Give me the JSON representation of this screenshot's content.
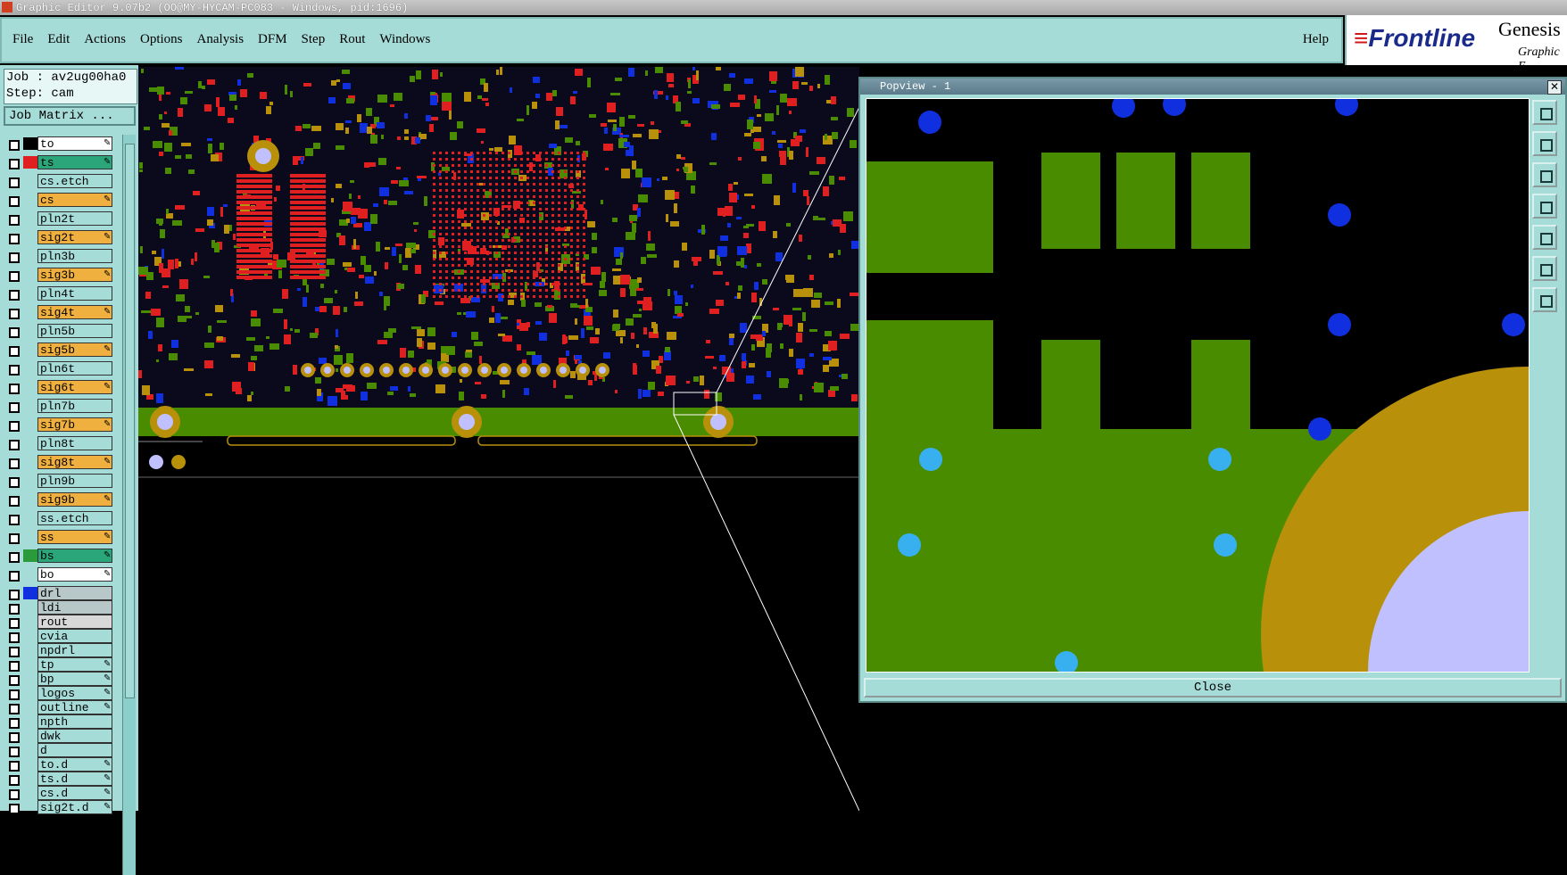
{
  "window": {
    "title": "Graphic Editor 9.07b2 (OO@MY-HYCAM-PC083 - Windows, pid:1696)"
  },
  "menu": {
    "items": [
      "File",
      "Edit",
      "Actions",
      "Options",
      "Analysis",
      "DFM",
      "Step",
      "Rout",
      "Windows"
    ],
    "help": "Help"
  },
  "brand": {
    "logo_text": "Frontline",
    "product": "Genesis",
    "subtitle": "Graphic E"
  },
  "info": {
    "job": "Job : av2ug00ha0",
    "step": "Step: cam"
  },
  "job_matrix_label": "Job Matrix ...",
  "layers": [
    {
      "name": "to",
      "color": "#ffffff",
      "swatch": "#000000",
      "locked": true
    },
    {
      "name": "ts",
      "color": "#2aa67a",
      "swatch": "#e02020",
      "locked": true
    },
    {
      "name": "cs.etch",
      "color": "#a6dcd8",
      "swatch": "",
      "locked": false
    },
    {
      "name": "cs",
      "color": "#f0b040",
      "swatch": "",
      "locked": true
    },
    {
      "name": "pln2t",
      "color": "#a6dcd8",
      "swatch": "",
      "locked": false
    },
    {
      "name": "sig2t",
      "color": "#f0b040",
      "swatch": "",
      "locked": true
    },
    {
      "name": "pln3b",
      "color": "#a6dcd8",
      "swatch": "",
      "locked": false
    },
    {
      "name": "sig3b",
      "color": "#f0b040",
      "swatch": "",
      "locked": true
    },
    {
      "name": "pln4t",
      "color": "#a6dcd8",
      "swatch": "",
      "locked": false
    },
    {
      "name": "sig4t",
      "color": "#f0b040",
      "swatch": "",
      "locked": true
    },
    {
      "name": "pln5b",
      "color": "#a6dcd8",
      "swatch": "",
      "locked": false
    },
    {
      "name": "sig5b",
      "color": "#f0b040",
      "swatch": "",
      "locked": true
    },
    {
      "name": "pln6t",
      "color": "#a6dcd8",
      "swatch": "",
      "locked": false
    },
    {
      "name": "sig6t",
      "color": "#f0b040",
      "swatch": "",
      "locked": true
    },
    {
      "name": "pln7b",
      "color": "#a6dcd8",
      "swatch": "",
      "locked": false
    },
    {
      "name": "sig7b",
      "color": "#f0b040",
      "swatch": "",
      "locked": true
    },
    {
      "name": "pln8t",
      "color": "#a6dcd8",
      "swatch": "",
      "locked": false
    },
    {
      "name": "sig8t",
      "color": "#f0b040",
      "swatch": "",
      "locked": true
    },
    {
      "name": "pln9b",
      "color": "#a6dcd8",
      "swatch": "",
      "locked": false
    },
    {
      "name": "sig9b",
      "color": "#f0b040",
      "swatch": "",
      "locked": true
    },
    {
      "name": "ss.etch",
      "color": "#a6dcd8",
      "swatch": "",
      "locked": false
    },
    {
      "name": "ss",
      "color": "#f0b040",
      "swatch": "",
      "locked": true
    },
    {
      "name": "bs",
      "color": "#2aa67a",
      "swatch": "#2a9a3a",
      "locked": true
    },
    {
      "name": "bo",
      "color": "#ffffff",
      "swatch": "",
      "locked": true
    },
    {
      "name": "drl",
      "color": "#b8c8c8",
      "swatch": "#1030e0",
      "locked": false
    },
    {
      "name": "ldi",
      "color": "#b8c8c8",
      "swatch": "",
      "locked": false
    },
    {
      "name": "rout",
      "color": "#d8d8d8",
      "swatch": "",
      "locked": false
    },
    {
      "name": "cvia",
      "color": "#a6dcd8",
      "swatch": "",
      "locked": false
    },
    {
      "name": "npdrl",
      "color": "#a6dcd8",
      "swatch": "",
      "locked": false
    },
    {
      "name": "tp",
      "color": "#a6dcd8",
      "swatch": "",
      "locked": true
    },
    {
      "name": "bp",
      "color": "#a6dcd8",
      "swatch": "",
      "locked": true
    },
    {
      "name": "logos",
      "color": "#a6dcd8",
      "swatch": "",
      "locked": true
    },
    {
      "name": "outline",
      "color": "#a6dcd8",
      "swatch": "",
      "locked": true
    },
    {
      "name": "npth",
      "color": "#a6dcd8",
      "swatch": "",
      "locked": false
    },
    {
      "name": "dwk",
      "color": "#a6dcd8",
      "swatch": "",
      "locked": false
    },
    {
      "name": "d",
      "color": "#a6dcd8",
      "swatch": "",
      "locked": false
    },
    {
      "name": "to.d",
      "color": "#a6dcd8",
      "swatch": "",
      "locked": true
    },
    {
      "name": "ts.d",
      "color": "#a6dcd8",
      "swatch": "",
      "locked": true
    },
    {
      "name": "cs.d",
      "color": "#a6dcd8",
      "swatch": "",
      "locked": true
    },
    {
      "name": "sig2t.d",
      "color": "#a6dcd8",
      "swatch": "",
      "locked": true
    }
  ],
  "popview": {
    "title": "Popview - 1",
    "close_label": "Close"
  },
  "colors": {
    "panel": "#a6dcd8",
    "board_green": "#4a8c00",
    "copper": "#b8900a",
    "via_blue": "#1030e0",
    "pad_light_blue": "#38b0f0",
    "hole": "#c0c0ff",
    "trace_red": "#e02020"
  }
}
